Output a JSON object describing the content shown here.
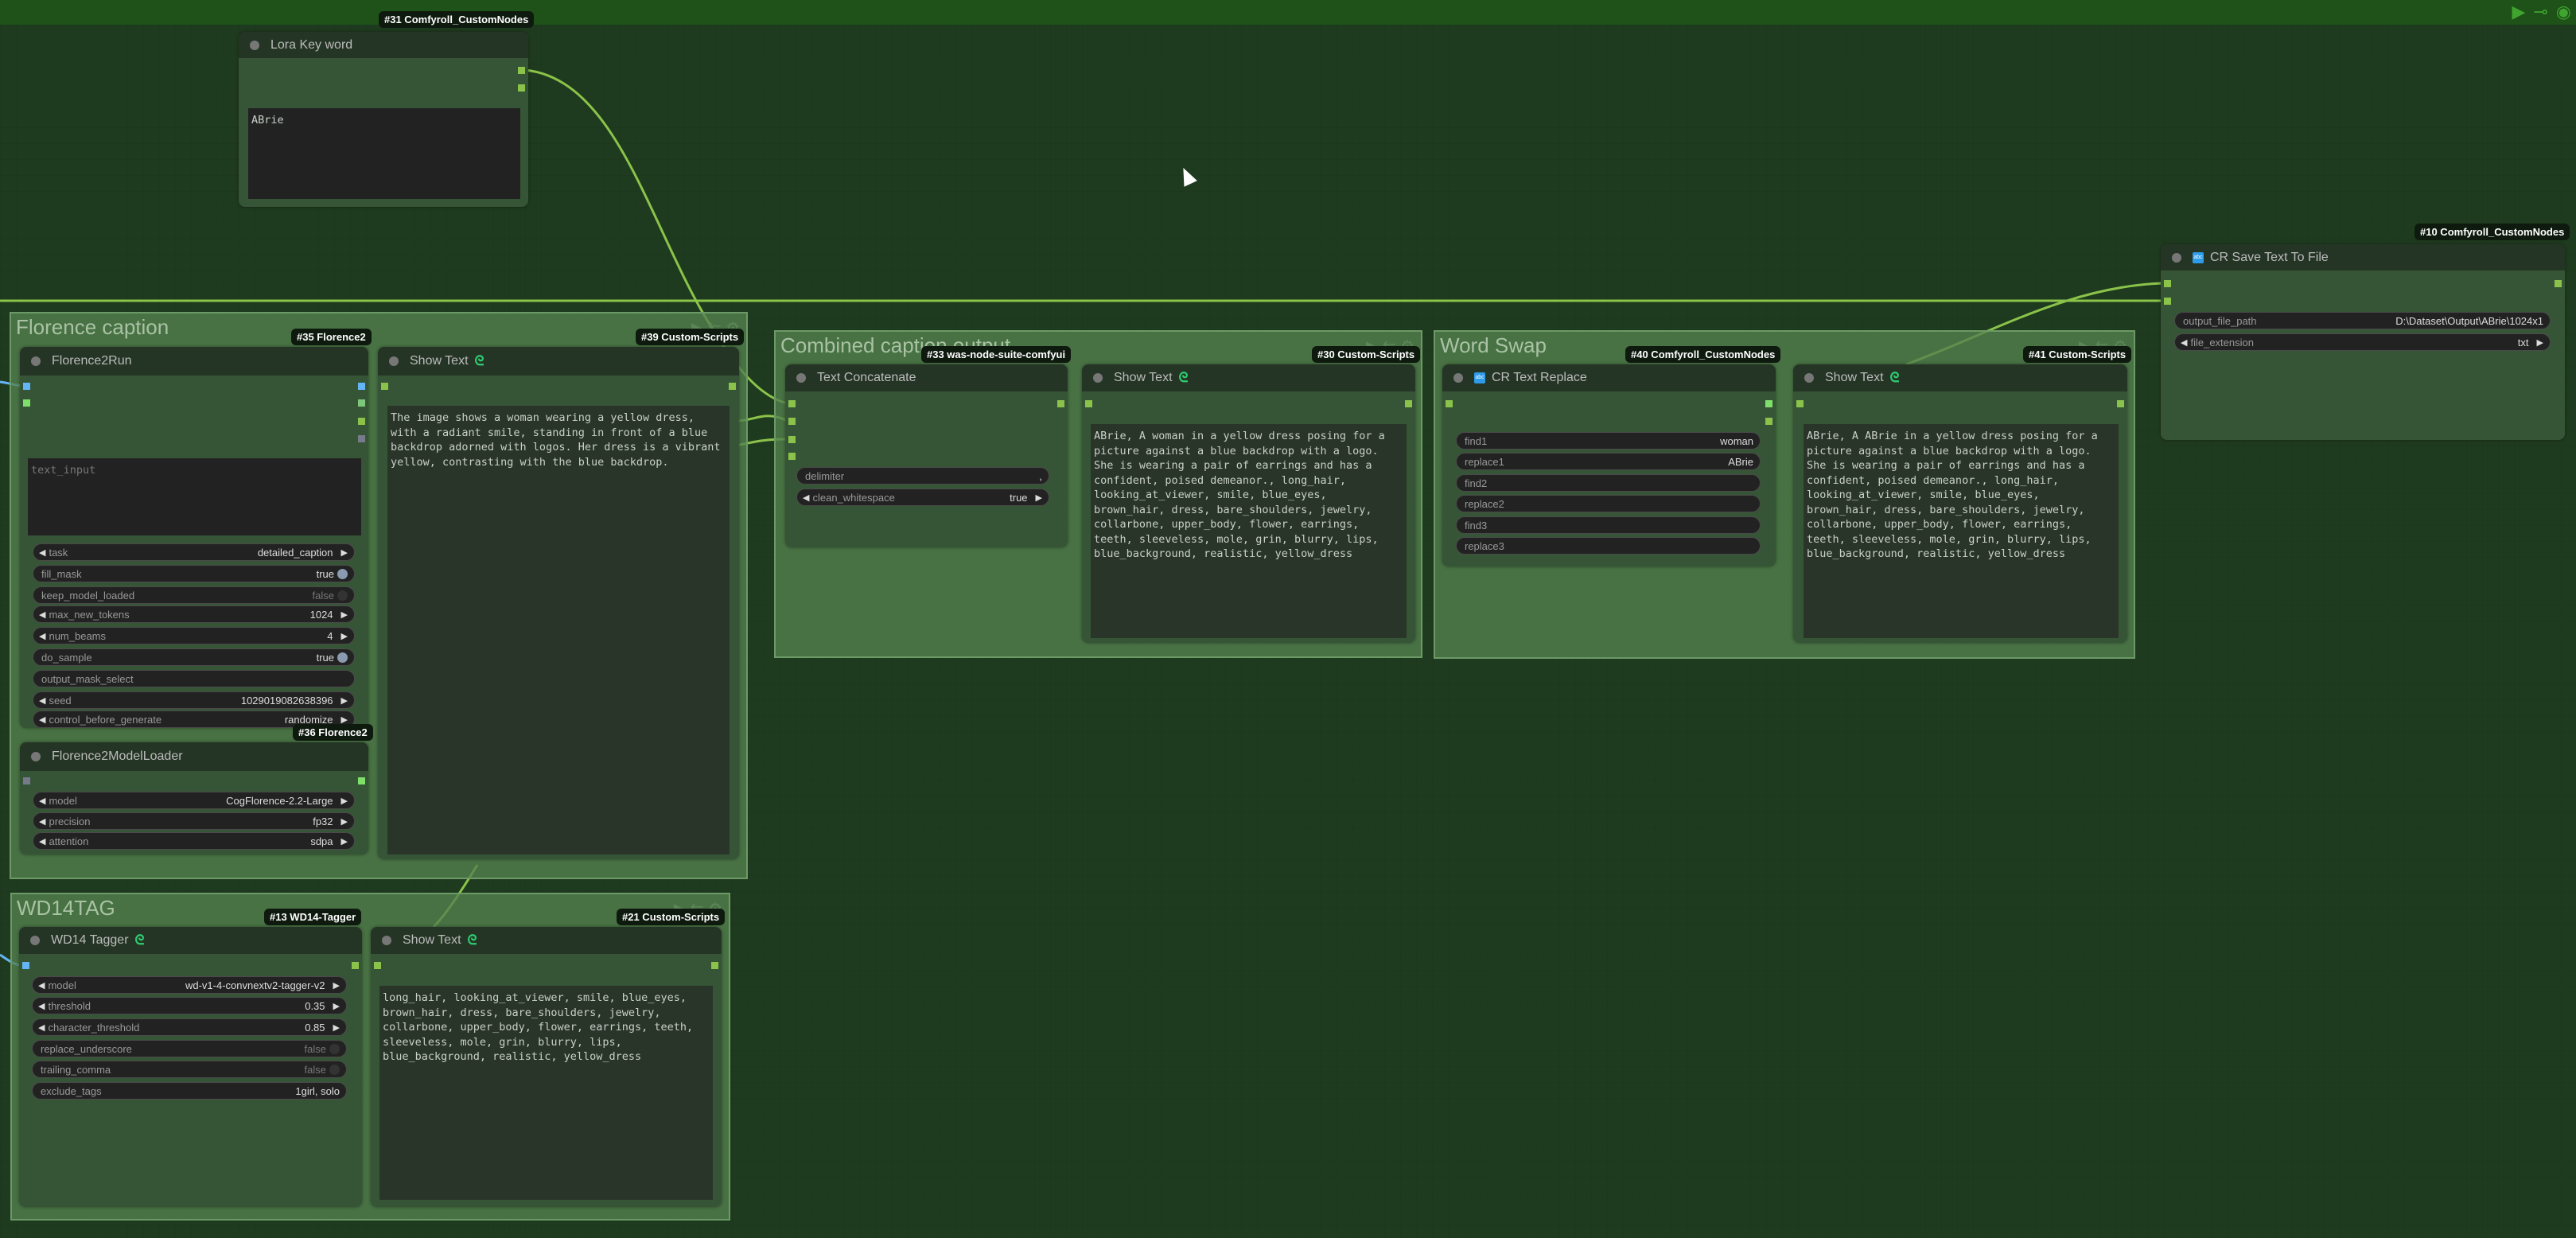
{
  "canvas": {
    "accent": "#8bc34a",
    "background": "#1f3b1f"
  },
  "groups": {
    "florence": {
      "title": "Florence caption"
    },
    "combined": {
      "title": "Combined caption output"
    },
    "wordswap": {
      "title": "Word Swap"
    },
    "wd14": {
      "title": "WD14TAG"
    }
  },
  "nodes": {
    "lora": {
      "badge": "#31 Comfyroll_CustomNodes",
      "title": "Lora Key word",
      "text": "ABrie"
    },
    "florence_run": {
      "badge": "#35 Florence2",
      "title": "Florence2Run",
      "placeholder": "text_input",
      "widgets": [
        {
          "label": "task",
          "value": "detailed_caption",
          "type": "combo"
        },
        {
          "label": "fill_mask",
          "value": "true",
          "type": "toggle"
        },
        {
          "label": "keep_model_loaded",
          "value": "false",
          "type": "toggle"
        },
        {
          "label": "max_new_tokens",
          "value": "1024",
          "type": "combo"
        },
        {
          "label": "num_beams",
          "value": "4",
          "type": "combo"
        },
        {
          "label": "do_sample",
          "value": "true",
          "type": "toggle"
        },
        {
          "label": "output_mask_select",
          "value": "",
          "type": "text"
        },
        {
          "label": "seed",
          "value": "1029019082638396",
          "type": "combo"
        },
        {
          "label": "control_before_generate",
          "value": "randomize",
          "type": "combo"
        }
      ]
    },
    "florence_loader": {
      "badge": "#36 Florence2",
      "title": "Florence2ModelLoader",
      "widgets": [
        {
          "label": "model",
          "value": "CogFlorence-2.2-Large",
          "type": "combo"
        },
        {
          "label": "precision",
          "value": "fp32",
          "type": "combo"
        },
        {
          "label": "attention",
          "value": "sdpa",
          "type": "combo"
        }
      ]
    },
    "show39": {
      "badge": "#39 Custom-Scripts",
      "title": "Show Text",
      "text": "The image shows a woman wearing a yellow dress, with a radiant smile, standing in front of a blue backdrop adorned with logos. Her dress is a vibrant yellow, contrasting with the blue backdrop."
    },
    "concat": {
      "badge": "#33 was-node-suite-comfyui",
      "title": "Text Concatenate",
      "widgets": [
        {
          "label": "delimiter",
          "value": ",",
          "type": "text"
        },
        {
          "label": "clean_whitespace",
          "value": "true",
          "type": "combo"
        }
      ]
    },
    "show30": {
      "badge": "#30 Custom-Scripts",
      "title": "Show Text",
      "text": "ABrie, A woman in a yellow dress posing for a picture against a blue backdrop with a logo. She is wearing a pair of earrings and has a confident, poised demeanor., long_hair, looking_at_viewer, smile, blue_eyes, brown_hair, dress, bare_shoulders, jewelry, collarbone, upper_body, flower, earrings, teeth, sleeveless, mole, grin, blurry, lips, blue_background, realistic, yellow_dress"
    },
    "replace": {
      "badge": "#40 Comfyroll_CustomNodes",
      "title": "CR Text Replace",
      "widgets": [
        {
          "label": "find1",
          "value": "woman",
          "type": "text"
        },
        {
          "label": "replace1",
          "value": "ABrie",
          "type": "text"
        },
        {
          "label": "find2",
          "value": "",
          "type": "text"
        },
        {
          "label": "replace2",
          "value": "",
          "type": "text"
        },
        {
          "label": "find3",
          "value": "",
          "type": "text"
        },
        {
          "label": "replace3",
          "value": "",
          "type": "text"
        }
      ]
    },
    "show41": {
      "badge": "#41 Custom-Scripts",
      "title": "Show Text",
      "text": "ABrie, A ABrie in a yellow dress posing for a picture against a blue backdrop with a logo. She is wearing a pair of earrings and has a confident, poised demeanor., long_hair, looking_at_viewer, smile, blue_eyes, brown_hair, dress, bare_shoulders, jewelry, collarbone, upper_body, flower, earrings, teeth, sleeveless, mole, grin, blurry, lips, blue_background, realistic, yellow_dress"
    },
    "wd14": {
      "badge": "#13 WD14-Tagger",
      "title": "WD14 Tagger",
      "widgets": [
        {
          "label": "model",
          "value": "wd-v1-4-convnextv2-tagger-v2",
          "type": "combo"
        },
        {
          "label": "threshold",
          "value": "0.35",
          "type": "combo"
        },
        {
          "label": "character_threshold",
          "value": "0.85",
          "type": "combo"
        },
        {
          "label": "replace_underscore",
          "value": "false",
          "type": "toggle"
        },
        {
          "label": "trailing_comma",
          "value": "false",
          "type": "toggle"
        },
        {
          "label": "exclude_tags",
          "value": "1girl, solo",
          "type": "text"
        }
      ]
    },
    "show21": {
      "badge": "#21 Custom-Scripts",
      "title": "Show Text",
      "text": "long_hair, looking_at_viewer, smile, blue_eyes, brown_hair, dress, bare_shoulders, jewelry, collarbone, upper_body, flower, earrings, teeth, sleeveless, mole, grin, blurry, lips, blue_background, realistic, yellow_dress"
    },
    "crsave": {
      "badge": "#10 Comfyroll_CustomNodes",
      "title": "CR Save Text To File",
      "widgets": [
        {
          "label": "output_file_path",
          "value": "D:\\Dataset\\Output\\ABrie\\1024x1",
          "type": "text"
        },
        {
          "label": "file_extension",
          "value": "txt",
          "type": "combo"
        }
      ]
    }
  }
}
